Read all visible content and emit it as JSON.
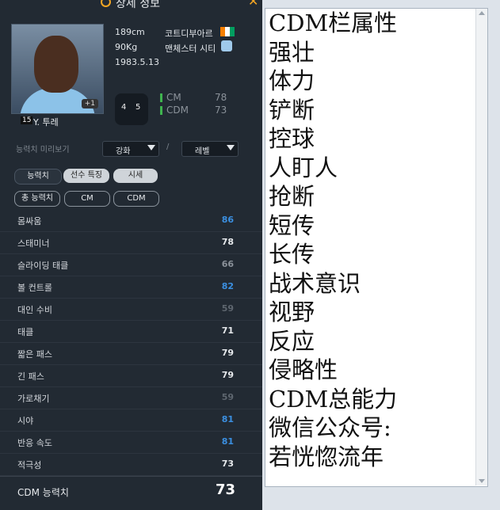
{
  "header": {
    "title": "상세 정보"
  },
  "player": {
    "name": "Y. 투레",
    "number": "15",
    "height": "189cm",
    "weight": "90Kg",
    "birth": "1983.5.13",
    "nation": "코트디부아르",
    "club": "맨체스터 시티",
    "card_plus": "+1",
    "skill_left": "4",
    "skill_right": "5",
    "positions": [
      {
        "pos": "CM",
        "value": "78"
      },
      {
        "pos": "CDM",
        "value": "73"
      }
    ]
  },
  "preview": {
    "label": "능력치 미리보기",
    "enhance": "강화",
    "sep": "/",
    "level": "레벨"
  },
  "tabs": [
    "능력치",
    "선수 특징",
    "시세"
  ],
  "subtabs": [
    "총 능력치",
    "CM",
    "CDM"
  ],
  "stats": [
    {
      "name": "몸싸움",
      "value": "86",
      "color": "#3b8fe0"
    },
    {
      "name": "스태미너",
      "value": "78",
      "color": "#e6e9ec"
    },
    {
      "name": "슬라이딩 태클",
      "value": "66",
      "color": "#8b929a"
    },
    {
      "name": "볼 컨트롤",
      "value": "82",
      "color": "#3b8fe0"
    },
    {
      "name": "대인 수비",
      "value": "59",
      "color": "#5e666f"
    },
    {
      "name": "태클",
      "value": "71",
      "color": "#e6e9ec"
    },
    {
      "name": "짧은 패스",
      "value": "79",
      "color": "#e6e9ec"
    },
    {
      "name": "긴 패스",
      "value": "79",
      "color": "#e6e9ec"
    },
    {
      "name": "가로채기",
      "value": "59",
      "color": "#5e666f"
    },
    {
      "name": "시야",
      "value": "81",
      "color": "#3b8fe0"
    },
    {
      "name": "반응 속도",
      "value": "81",
      "color": "#3b8fe0"
    },
    {
      "name": "적극성",
      "value": "73",
      "color": "#e6e9ec"
    }
  ],
  "total": {
    "label": "CDM 능력치",
    "value": "73"
  },
  "editor_lines": [
    "CDM栏属性",
    "强壮",
    "体力",
    "铲断",
    "控球",
    "人盯人",
    "抢断",
    "短传",
    "长传",
    "战术意识",
    "视野",
    "反应",
    "侵略性",
    "CDM总能力",
    "微信公众号:",
    "若恍惚流年"
  ],
  "colors": {
    "accent": "#f5a623",
    "blue_stat": "#3b8fe0",
    "panel_bg": "#222a33",
    "green_bar": "#3fb44f"
  }
}
